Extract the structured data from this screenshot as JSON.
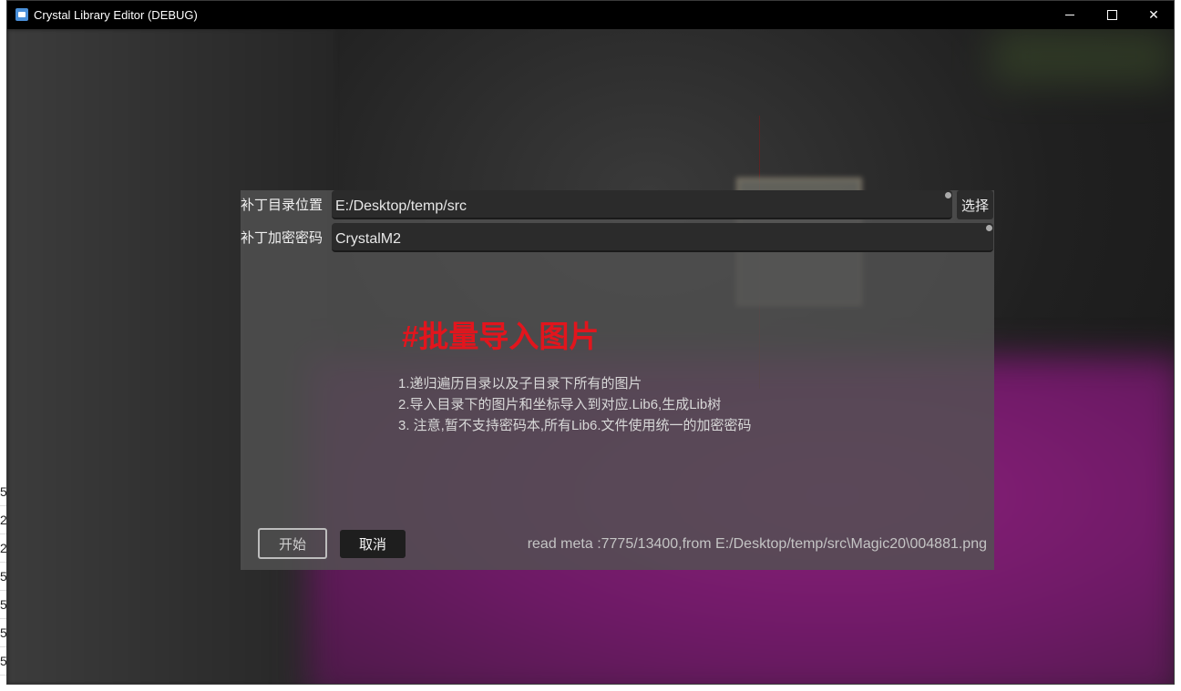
{
  "window": {
    "title": "Crystal Library Editor (DEBUG)",
    "minimize_glyph": "",
    "maximize_glyph": "",
    "close_glyph": "✕"
  },
  "background_lines": [
    "5",
    "2",
    "2",
    "5",
    "5",
    "5",
    "5"
  ],
  "dialog": {
    "patch_dir_label": "补丁目录位置",
    "patch_dir_value": "E:/Desktop/temp/src",
    "select_label": "选择",
    "password_label": "补丁加密密码",
    "password_value": "CrystalM2",
    "heading": "#批量导入图片",
    "notes": [
      "1.递归遍历目录以及子目录下所有的图片",
      "2.导入目录下的图片和坐标导入到对应.Lib6,生成Lib树",
      "3. 注意,暂不支持密码本,所有Lib6.文件使用统一的加密密码"
    ],
    "start_label": "开始",
    "cancel_label": "取消",
    "status": "read meta :7775/13400,from E:/Desktop/temp/src\\Magic20\\004881.png"
  },
  "colors": {
    "heading": "#e2151d",
    "titlebar": "#000000",
    "field_bg": "#2b2b2b"
  }
}
